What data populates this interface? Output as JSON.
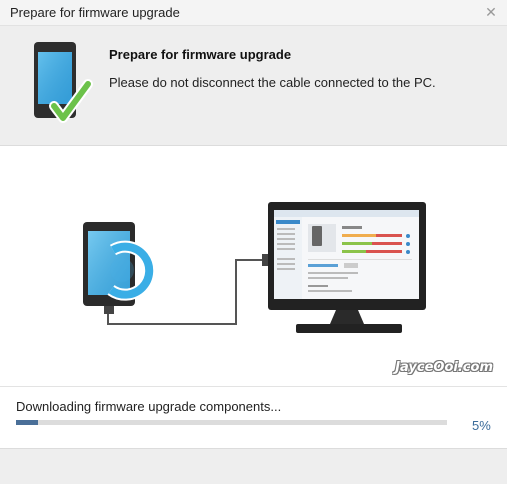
{
  "window": {
    "title": "Prepare for firmware upgrade",
    "close_icon": "close-icon"
  },
  "header": {
    "icon": "phone-check-icon",
    "title": "Prepare for firmware upgrade",
    "subtitle": "Please do not disconnect the cable connected to the PC."
  },
  "illustration": {
    "watermark": "JayceOoi.com",
    "accent_color": "#3aaee6",
    "check_color": "#6cc24a"
  },
  "progress": {
    "label": "Downloading firmware upgrade components...",
    "value": 0.05,
    "percent_text": "5%",
    "fill_color": "#4a6f98"
  }
}
